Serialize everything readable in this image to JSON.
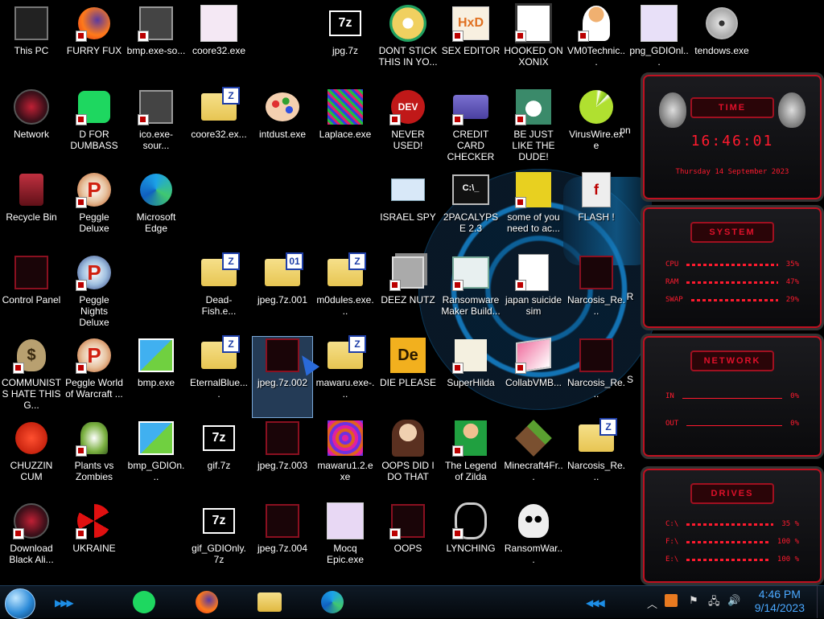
{
  "desktop": {
    "icons": [
      {
        "label": "This PC"
      },
      {
        "label": "FURRY FUX"
      },
      {
        "label": "bmp.exe-so..."
      },
      {
        "label": "coore32.exe"
      },
      {
        "label": "jpg.7z"
      },
      {
        "label": "DONT STICK THIS IN YO..."
      },
      {
        "label": "SEX EDITOR"
      },
      {
        "label": "HOOKED ON XONIX"
      },
      {
        "label": "VM0Technic..."
      },
      {
        "label": "png_GDIOnl..."
      },
      {
        "label": "tendows.exe"
      },
      {
        "label": "Network"
      },
      {
        "label": "D FOR DUMBASS"
      },
      {
        "label": "ico.exe-sour..."
      },
      {
        "label": "coore32.ex..."
      },
      {
        "label": "intdust.exe"
      },
      {
        "label": "Laplace.exe"
      },
      {
        "label": "NEVER USED!"
      },
      {
        "label": "CREDIT CARD CHECKER"
      },
      {
        "label": "BE JUST LIKE THE DUDE!"
      },
      {
        "label": "VirusWire.exe"
      },
      {
        "label": "pn"
      },
      {
        "label": "Recycle Bin"
      },
      {
        "label": "Peggle Deluxe"
      },
      {
        "label": "Microsoft Edge"
      },
      {
        "label": "ISRAEL SPY"
      },
      {
        "label": "2PACALYPSE 2.3"
      },
      {
        "label": "some of you need to ac..."
      },
      {
        "label": "FLASH !"
      },
      {
        "label": "Control Panel"
      },
      {
        "label": "Peggle Nights Deluxe"
      },
      {
        "label": "Dead-Fish.e..."
      },
      {
        "label": "jpeg.7z.001"
      },
      {
        "label": "m0dules.exe..."
      },
      {
        "label": "DEEZ NUTZ"
      },
      {
        "label": "Ransomware Maker Build..."
      },
      {
        "label": "japan suicide sim"
      },
      {
        "label": "Narcosis_Re..."
      },
      {
        "label": "R"
      },
      {
        "label": "COMMUNISTS HATE THIS G..."
      },
      {
        "label": "Peggle World of Warcraft ..."
      },
      {
        "label": "bmp.exe"
      },
      {
        "label": "EternalBlue...."
      },
      {
        "label": "jpeg.7z.002"
      },
      {
        "label": "mawaru.exe-..."
      },
      {
        "label": "DIE PLEASE"
      },
      {
        "label": "SuperHilda"
      },
      {
        "label": "CollabVMB..."
      },
      {
        "label": "Narcosis_Re..."
      },
      {
        "label": "S"
      },
      {
        "label": "CHUZZIN CUM"
      },
      {
        "label": "Plants vs Zombies"
      },
      {
        "label": "bmp_GDIOn..."
      },
      {
        "label": "gif.7z"
      },
      {
        "label": "jpeg.7z.003"
      },
      {
        "label": "mawaru1.2.exe"
      },
      {
        "label": "OOPS DID I DO THAT"
      },
      {
        "label": "The Legend of Zilda"
      },
      {
        "label": "Minecraft4Fr..."
      },
      {
        "label": "Narcosis_Re..."
      },
      {
        "label": "Download Black Ali..."
      },
      {
        "label": "UKRAINE"
      },
      {
        "label": "gif_GDIOnly.7z"
      },
      {
        "label": "jpeg.7z.004"
      },
      {
        "label": "Mocq Epic.exe"
      },
      {
        "label": "OOPS"
      },
      {
        "label": "LYNCHING"
      },
      {
        "label": "RansomWar..."
      }
    ],
    "folder_tags": {
      "z": "Z",
      "part1": "01"
    },
    "zip_text": "7z"
  },
  "gadgets": {
    "time": {
      "title": "TIME",
      "clock": "16:46:01",
      "date": "Thursday 14 September 2023"
    },
    "system": {
      "title": "SYSTEM",
      "rows": [
        {
          "name": "CPU",
          "value": "35%"
        },
        {
          "name": "RAM",
          "value": "47%"
        },
        {
          "name": "SWAP",
          "value": "29%"
        }
      ]
    },
    "network": {
      "title": "NETWORK",
      "rows": [
        {
          "name": "IN",
          "value": "0%"
        },
        {
          "name": "OUT",
          "value": "0%"
        }
      ]
    },
    "drives": {
      "title": "DRIVES",
      "rows": [
        {
          "name": "C:\\",
          "value": "35 %"
        },
        {
          "name": "F:\\",
          "value": "100 %"
        },
        {
          "name": "E:\\",
          "value": "100 %"
        }
      ]
    }
  },
  "taskbar": {
    "apps": [
      {
        "icon": "spotify-icon"
      },
      {
        "icon": "firefox-icon"
      },
      {
        "icon": "file-explorer-icon"
      },
      {
        "icon": "edge-icon"
      }
    ],
    "clock": {
      "time": "4:46 PM",
      "date": "9/14/2023"
    }
  },
  "colors": {
    "accent_red": "#ff1a2e",
    "taskbar_blue": "#1d8ee6"
  }
}
